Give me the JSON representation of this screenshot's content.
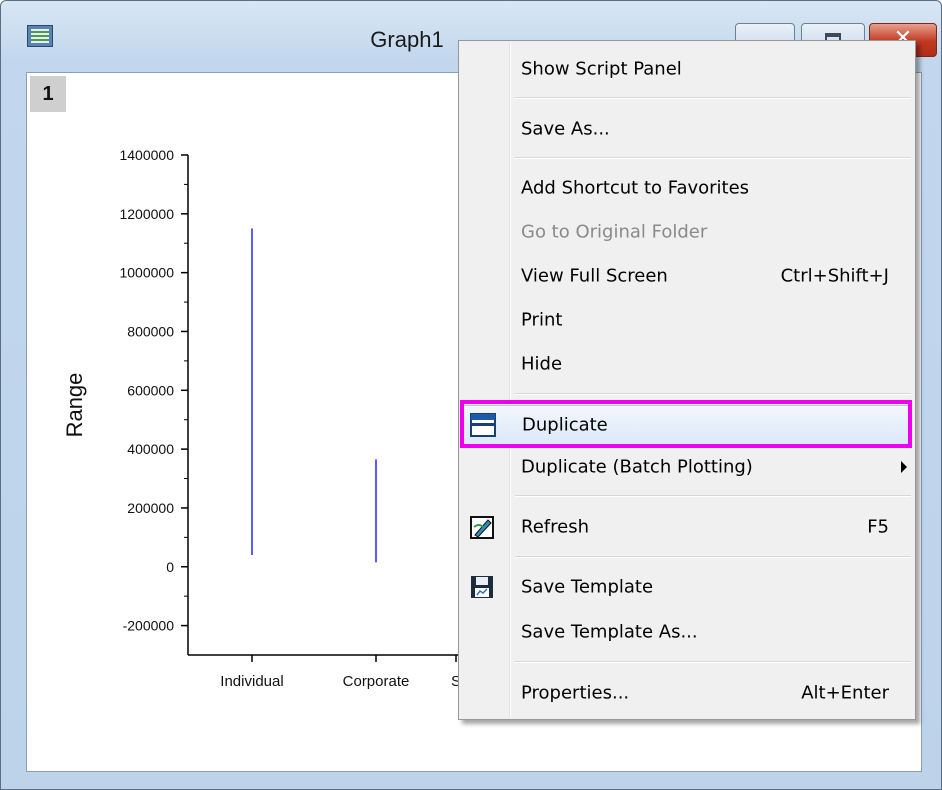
{
  "window": {
    "title": "Graph1",
    "close_glyph": "✕"
  },
  "graph": {
    "layer_label": "1"
  },
  "chart_data": {
    "type": "bar",
    "title": "",
    "ylabel": "Range",
    "xlabel": "",
    "categories": [
      "Individual",
      "Corporate",
      "S"
    ],
    "series": [
      {
        "low": [
          40000,
          15000,
          null
        ],
        "high": [
          1150000,
          365000,
          null
        ]
      }
    ],
    "ylim": [
      -300000,
      1400000
    ],
    "yticks": [
      "-200000",
      "0",
      "200000",
      "400000",
      "600000",
      "800000",
      "1000000",
      "1200000",
      "1400000"
    ],
    "line_color": "#3333ff"
  },
  "context_menu": {
    "items": [
      {
        "label": "Show Script Panel"
      },
      {
        "label": "Save As..."
      },
      {
        "label": "Add Shortcut to Favorites"
      },
      {
        "label": "Go to Original Folder",
        "disabled": true
      },
      {
        "label": "View Full Screen",
        "shortcut": "Ctrl+Shift+J"
      },
      {
        "label": "Print"
      },
      {
        "label": "Hide"
      },
      {
        "label": "Duplicate",
        "icon": "duplicate-icon",
        "highlighted": true
      },
      {
        "label": "Duplicate (Batch Plotting)",
        "submenu": true
      },
      {
        "label": "Refresh",
        "icon": "refresh-icon",
        "shortcut": "F5"
      },
      {
        "label": "Save Template",
        "icon": "save-template-icon"
      },
      {
        "label": "Save Template As..."
      },
      {
        "label": "Properties...",
        "shortcut": "Alt+Enter"
      }
    ]
  },
  "colors": {
    "highlight_border": "#ee00ee",
    "menu_bg": "#f0f0f0",
    "bar_color": "#3333ff"
  }
}
